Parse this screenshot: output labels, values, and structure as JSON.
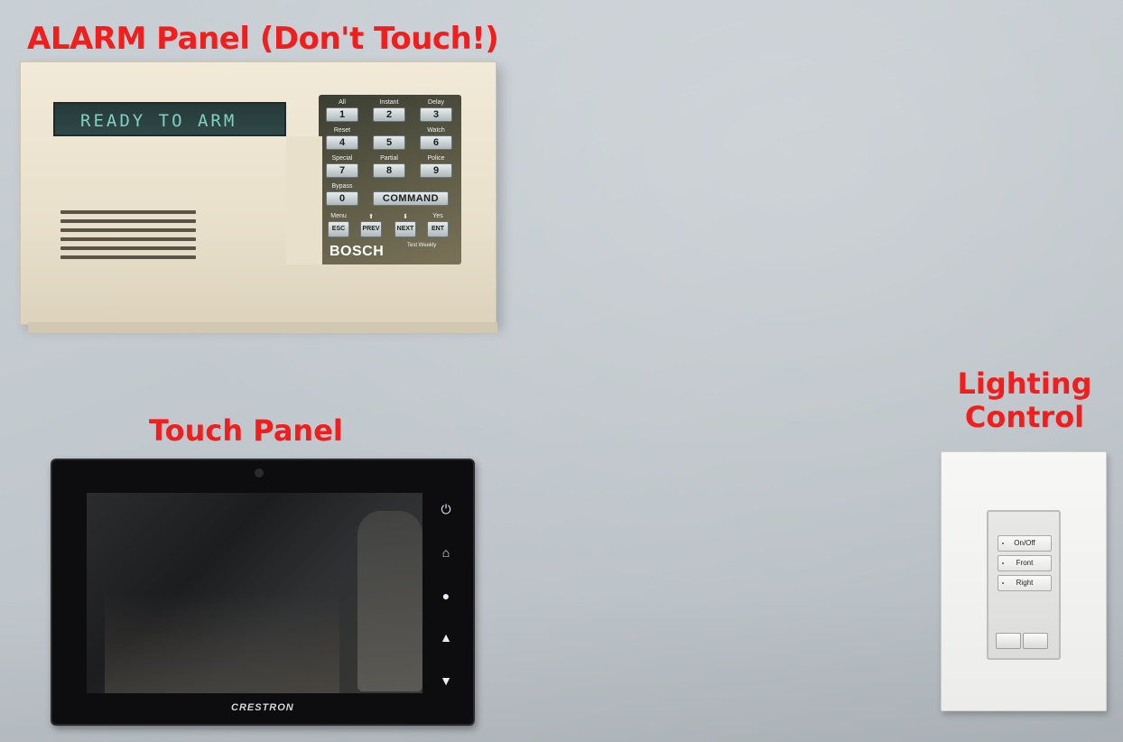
{
  "labels": {
    "alarm": "ALARM Panel (Don't Touch!)",
    "touch": "Touch Panel",
    "lighting_line1": "Lighting",
    "lighting_line2": "Control"
  },
  "alarm_panel": {
    "display_text": "READY TO ARM",
    "brand": "BOSCH",
    "footer_note": "Test Weekly",
    "keys": [
      {
        "caption": "All",
        "label": "1"
      },
      {
        "caption": "Instant",
        "label": "2"
      },
      {
        "caption": "Delay",
        "label": "3"
      },
      {
        "caption": "Reset",
        "label": "4"
      },
      {
        "caption": "",
        "label": "5"
      },
      {
        "caption": "Watch",
        "label": "6"
      },
      {
        "caption": "Special",
        "label": "7"
      },
      {
        "caption": "Partial",
        "label": "8"
      },
      {
        "caption": "Police",
        "label": "9"
      },
      {
        "caption": "Bypass",
        "label": "0"
      },
      {
        "caption": "",
        "label": "COMMAND"
      },
      {
        "caption": "Menu",
        "label": "ESC"
      },
      {
        "caption": "⬆",
        "label": "PREV"
      },
      {
        "caption": "⬇",
        "label": "NEXT"
      },
      {
        "caption": "Yes",
        "label": "ENT"
      }
    ]
  },
  "touch_panel": {
    "brand": "CRESTRON",
    "side_icons": [
      "power-icon",
      "home-icon",
      "light-bulb-icon",
      "up-arrow-icon",
      "down-arrow-icon"
    ]
  },
  "lighting_control": {
    "buttons": [
      "On/Off",
      "Front",
      "Right"
    ]
  },
  "colors": {
    "label_red": "#f21d1d",
    "wall": "#c3cacf",
    "alarm_case": "#e9e0cb",
    "lcd_text": "#7fd1c2"
  }
}
